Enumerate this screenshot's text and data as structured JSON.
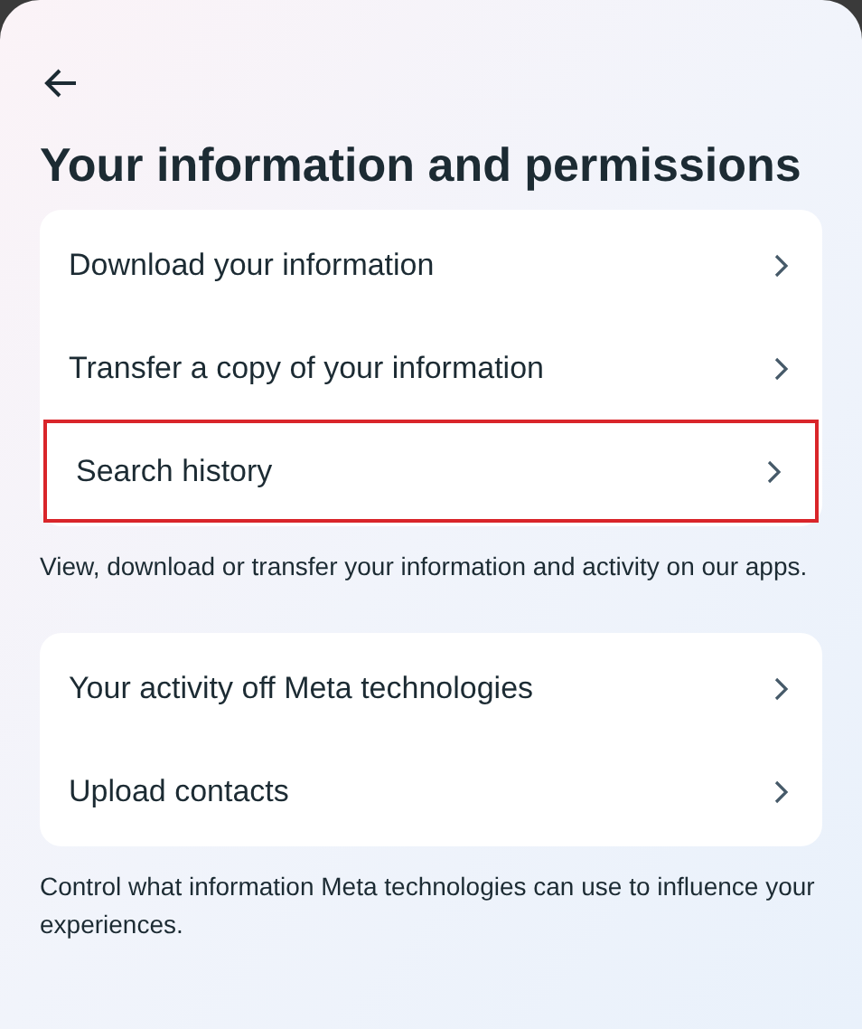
{
  "title": "Your information and permissions",
  "sections": [
    {
      "items": [
        {
          "label": "Download your information",
          "highlighted": false
        },
        {
          "label": "Transfer a copy of your information",
          "highlighted": false
        },
        {
          "label": "Search history",
          "highlighted": true
        }
      ],
      "description": "View, download or transfer your information and activity on our apps."
    },
    {
      "items": [
        {
          "label": "Your activity off Meta technologies",
          "highlighted": false
        },
        {
          "label": "Upload contacts",
          "highlighted": false
        }
      ],
      "description": "Control what information Meta technologies can use to influence your experiences."
    }
  ]
}
